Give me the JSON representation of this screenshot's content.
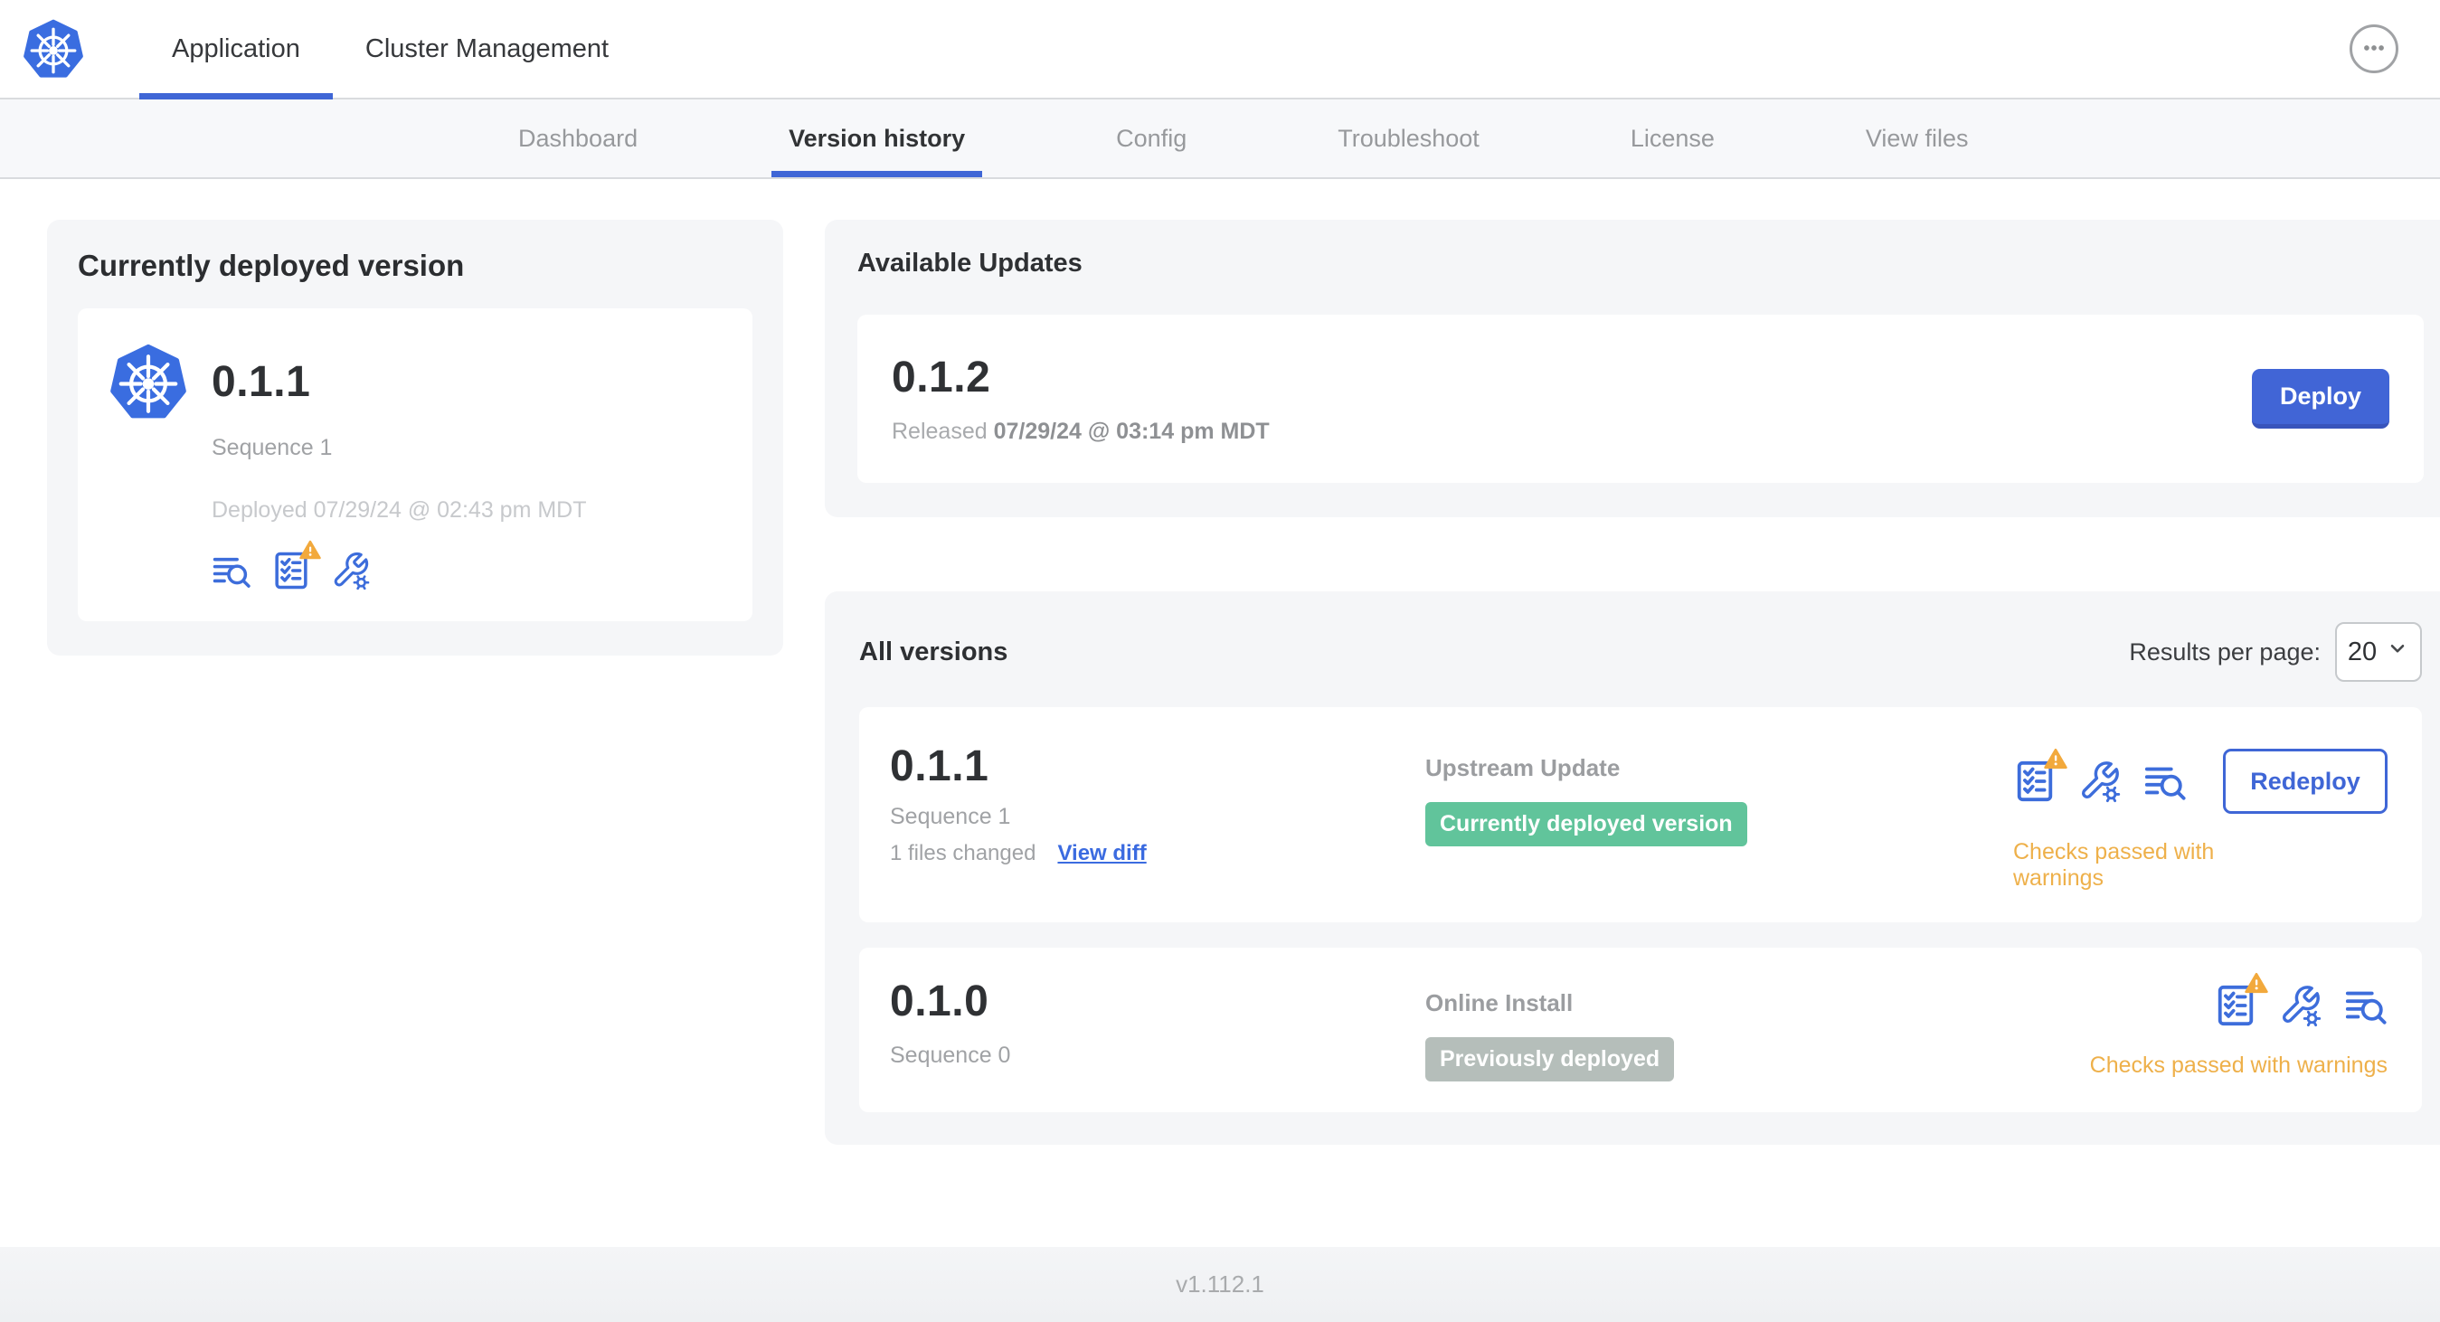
{
  "topbar": {
    "tabs": [
      {
        "label": "Application",
        "active": true
      },
      {
        "label": "Cluster Management",
        "active": false
      }
    ]
  },
  "subnav": {
    "items": [
      "Dashboard",
      "Version history",
      "Config",
      "Troubleshoot",
      "License",
      "View files"
    ],
    "active": "Version history"
  },
  "deployed_card": {
    "title": "Currently deployed version",
    "version": "0.1.1",
    "sequence": "Sequence 1",
    "deployed_at": "Deployed 07/29/24 @ 02:43 pm MDT",
    "icons": [
      "release-notes",
      "preflight-checks-warning",
      "config"
    ]
  },
  "available_updates": {
    "title": "Available Updates",
    "version": "0.1.2",
    "released_label": "Released",
    "released_date": "07/29/24 @ 03:14 pm MDT",
    "deploy_label": "Deploy"
  },
  "all_versions": {
    "title": "All versions",
    "results_per_page_label": "Results per page:",
    "results_per_page_value": "20",
    "rows": [
      {
        "version": "0.1.1",
        "sequence": "Sequence 1",
        "files_changed": "1 files changed",
        "view_diff_label": "View diff",
        "source": "Upstream Update",
        "badge": "Currently deployed version",
        "badge_color": "#61c49b",
        "status": "Checks passed with warnings",
        "action_label": "Redeploy",
        "icons": [
          "preflight-checks-warning",
          "config",
          "release-notes"
        ]
      },
      {
        "version": "0.1.0",
        "sequence": "Sequence 0",
        "source": "Online Install",
        "badge": "Previously deployed",
        "badge_color": "#b5beba",
        "status": "Checks passed with warnings",
        "icons": [
          "preflight-checks-warning",
          "config",
          "release-notes"
        ]
      }
    ]
  },
  "footer": {
    "app_version": "v1.112.1"
  },
  "colors": {
    "primary_blue": "#3f66d6",
    "button_blue": "#4165d6",
    "icon_blue": "#3d6ddb",
    "link_blue": "#3b6be0",
    "badge_green": "#61c49b",
    "badge_gray": "#b5beba",
    "status_amber": "#eeb04a",
    "warning_triangle": "#f2a93c",
    "panel_gray": "#f5f6f8",
    "kubernetes_blue": "#3a6de0"
  }
}
